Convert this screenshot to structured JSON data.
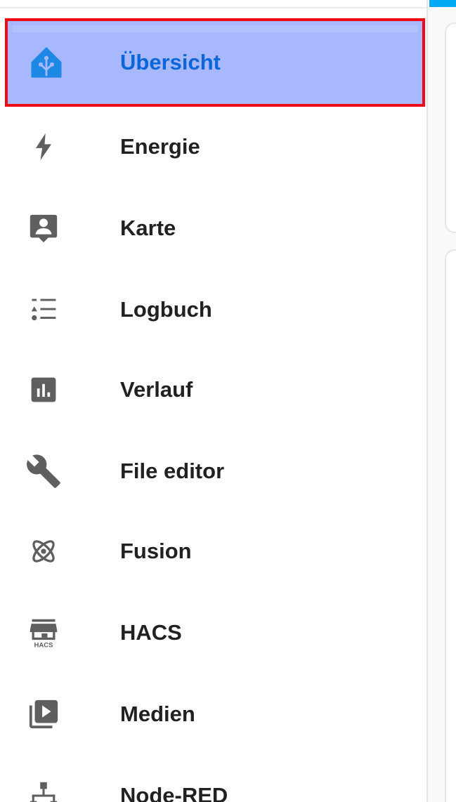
{
  "sidebar": {
    "items": [
      {
        "label": "Übersicht",
        "icon": "home-assistant-icon",
        "selected": true
      },
      {
        "label": "Energie",
        "icon": "lightning-bolt-icon"
      },
      {
        "label": "Karte",
        "icon": "map-account-icon"
      },
      {
        "label": "Logbuch",
        "icon": "logbook-list-icon"
      },
      {
        "label": "Verlauf",
        "icon": "chart-box-icon"
      },
      {
        "label": "File editor",
        "icon": "wrench-icon"
      },
      {
        "label": "Fusion",
        "icon": "atom-icon"
      },
      {
        "label": "HACS",
        "icon": "hacs-store-icon",
        "icon_text": "HACS"
      },
      {
        "label": "Medien",
        "icon": "play-box-multiple-icon"
      },
      {
        "label": "Node-RED",
        "icon": "sitemap-icon"
      }
    ]
  },
  "colors": {
    "selected_background": "#a8b8ff",
    "selected_border": "#ee0a14",
    "selected_text": "#0a66d9",
    "icon": "#5f5f5f",
    "text": "#212121",
    "accent": "#03a9f4",
    "home_assistant_blue": "#1e88e5"
  }
}
